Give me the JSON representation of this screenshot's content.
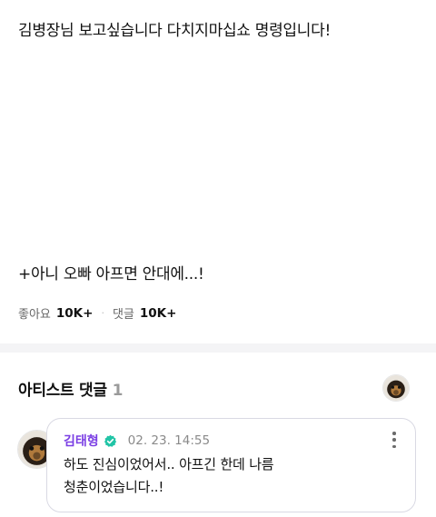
{
  "post": {
    "line1": "김병장님 보고싶습니다 다치지마십쇼 명령입니다!",
    "line2": "+아니 오빠 아프면 안대에...!"
  },
  "stats": {
    "likes_label": "좋아요",
    "likes_count": "10K+",
    "separator": "·",
    "comments_label": "댓글",
    "comments_count": "10K+"
  },
  "artist_comments": {
    "title": "아티스트 댓글",
    "count": "1"
  },
  "comment": {
    "author": "김태형",
    "timestamp": "02. 23. 14:55",
    "text_line1": "하도 진심이었어서.. 아프긴 한데 나름",
    "text_line2": "청춘이었습니다..!",
    "author_color": "#7b3fe4"
  },
  "icons": {
    "verified": "verified-badge-icon",
    "more": "more-vertical-icon"
  }
}
